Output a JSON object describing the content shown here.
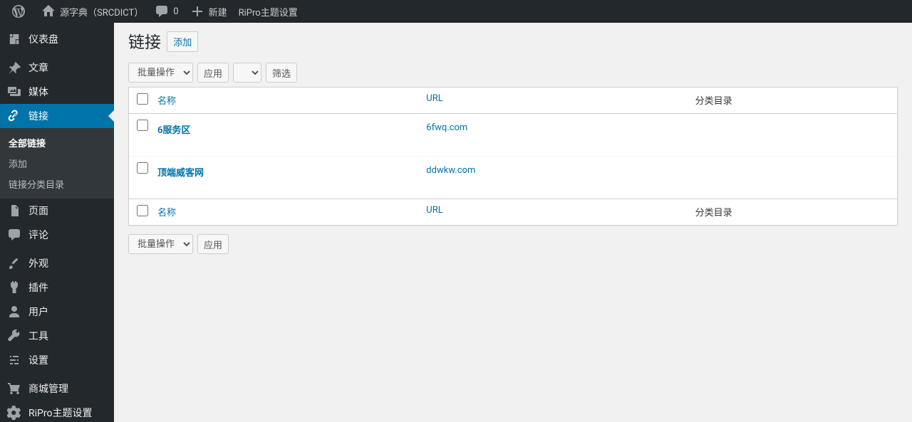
{
  "adminbar": {
    "site_name": "源字典（SRCDICT）",
    "comments_count": "0",
    "new_label": "新建",
    "ripro_label": "RiPro主题设置"
  },
  "menu": {
    "dashboard": "仪表盘",
    "posts": "文章",
    "media": "媒体",
    "links": "链接",
    "links_sub": {
      "all": "全部链接",
      "add": "添加",
      "cats": "链接分类目录"
    },
    "pages": "页面",
    "comments": "评论",
    "appearance": "外观",
    "plugins": "插件",
    "users": "用户",
    "tools": "工具",
    "settings": "设置",
    "shop": "商城管理",
    "ripro": "RiPro主题设置"
  },
  "page": {
    "title": "链接",
    "add_new": "添加"
  },
  "bulk": {
    "label": "批量操作",
    "apply": "应用",
    "filter": "筛选"
  },
  "table": {
    "headers": {
      "name": "名称",
      "url": "URL",
      "cats": "分类目录"
    },
    "rows": [
      {
        "name": "6服务区",
        "url": "6fwq.com",
        "cats": ""
      },
      {
        "name": "顶端威客网",
        "url": "ddwkw.com",
        "cats": ""
      }
    ]
  }
}
